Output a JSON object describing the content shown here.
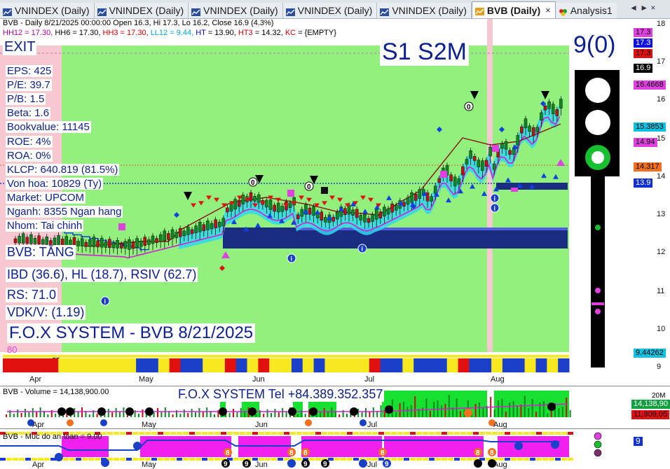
{
  "tabs": [
    {
      "label": "VNINDEX (Daily)",
      "active": false
    },
    {
      "label": "VNINDEX (Daily)",
      "active": false
    },
    {
      "label": "VNINDEX (Daily)",
      "active": false
    },
    {
      "label": "VNINDEX (Daily)",
      "active": false
    },
    {
      "label": "VNINDEX (Daily)",
      "active": false
    },
    {
      "label": "BVB (Daily)",
      "active": true
    },
    {
      "label": "Analysis1",
      "active": false
    }
  ],
  "tab_close": "×",
  "nav_arrows": "◄ ► ×",
  "header": {
    "line1": "BVB - Daily 8/21/2025 00:00:00 Open 16.3, Hi 17.3, Lo 16.2, Close 16.9 (4.3%)",
    "line2": [
      {
        "text": "HH12 = 17.30,",
        "color": "#b0009a"
      },
      {
        "text": "HH6 = 17.30,",
        "color": "#000000"
      },
      {
        "text": "HH3 = 17.30,",
        "color": "#d00000"
      },
      {
        "text": "LL12 = 9.44,",
        "color": "#00a0d0"
      },
      {
        "text": "HT",
        "color": "#0000c0"
      },
      {
        "text": " = 13.90,",
        "color": "#000000"
      },
      {
        "text": "HT3",
        "color": "#d00000"
      },
      {
        "text": " = 14.32,",
        "color": "#000000"
      },
      {
        "text": "KC",
        "color": "#d00000"
      },
      {
        "text": " = {EMPTY}",
        "color": "#000000"
      }
    ]
  },
  "exit_label": "EXIT",
  "fundamentals": [
    "EPS: 425",
    "P/E: 39.7",
    "P/B: 1.5",
    "Beta: 1.6",
    "Bookvalue: 11145",
    "ROE: 4%",
    "ROA: 0%",
    "KLCP: 640.819 (81.5%)",
    "Von hoa: 10829 (Ty)",
    "Market: UPCOM",
    "Nganh: 8355 Ngan hang",
    "Nhom: Tai chinh"
  ],
  "status": {
    "trend": "BVB: TĂNG",
    "ibd": "IBD (36.6), HL (18.7), RSIV (62.7)",
    "rs": "RS: 71.0",
    "vdk": "VDK/V:  (1.19)",
    "system_title": "F.O.X SYSTEM - BVB 8/21/2025",
    "eighty": "80"
  },
  "signal_label": "S1  S2M",
  "score_label": "9(0)",
  "price_axis": {
    "ticks": [
      "18",
      "17",
      "16",
      "15",
      "14",
      "13",
      "12",
      "11",
      "10",
      "9"
    ],
    "badges": [
      {
        "text": "17.3",
        "bg": "#e040e0",
        "fg": "#000000"
      },
      {
        "text": "17.3",
        "bg": "#1010e0",
        "fg": "#ffffff"
      },
      {
        "text": "17.3",
        "bg": "#e01010",
        "fg": "#000000"
      },
      {
        "text": "16.9",
        "bg": "#000000",
        "fg": "#ffffff"
      },
      {
        "text": "16.4668",
        "bg": "#e040e0",
        "fg": "#000000"
      },
      {
        "text": "15.3853",
        "bg": "#10c0e0",
        "fg": "#000000"
      },
      {
        "text": "14.94",
        "bg": "#e040e0",
        "fg": "#000000"
      },
      {
        "text": "14.317",
        "bg": "#f07020",
        "fg": "#000000"
      },
      {
        "text": "13.9",
        "bg": "#1030d0",
        "fg": "#ffffff"
      },
      {
        "text": "9.44262",
        "bg": "#10c0e0",
        "fg": "#000000"
      }
    ]
  },
  "x_axis": {
    "labels": [
      "Apr",
      "May",
      "Jun",
      "Jul",
      "Aug"
    ]
  },
  "volume_panel": {
    "title": "BVB - Volume = 14,138,900.00",
    "tel": "F.O.X SYSTEM Tel +84.389.352.357",
    "axis_tick": "20M",
    "badges": [
      {
        "text": "14,138,90",
        "bg": "#10a040",
        "fg": "#ffffff"
      },
      {
        "text": "11,909,05",
        "bg": "#e01010",
        "fg": "#000000"
      }
    ]
  },
  "safety_panel": {
    "title": "BVB - Muc do an toan = 9.00",
    "badge": "9"
  },
  "colors": {
    "chart_bg": "#92f07c",
    "pink_zone": "#f8c8d0",
    "dark_blue": "#1a2d80",
    "band_cyan": "#30d8f0"
  },
  "markers": {
    "info_glyph": "i",
    "zero_glyph": "0",
    "nine_glyph": "9",
    "eight_glyph": "8"
  },
  "icons": [
    "chart-tab-icon",
    "palette-tab-icon",
    "traffic-light-icon"
  ]
}
